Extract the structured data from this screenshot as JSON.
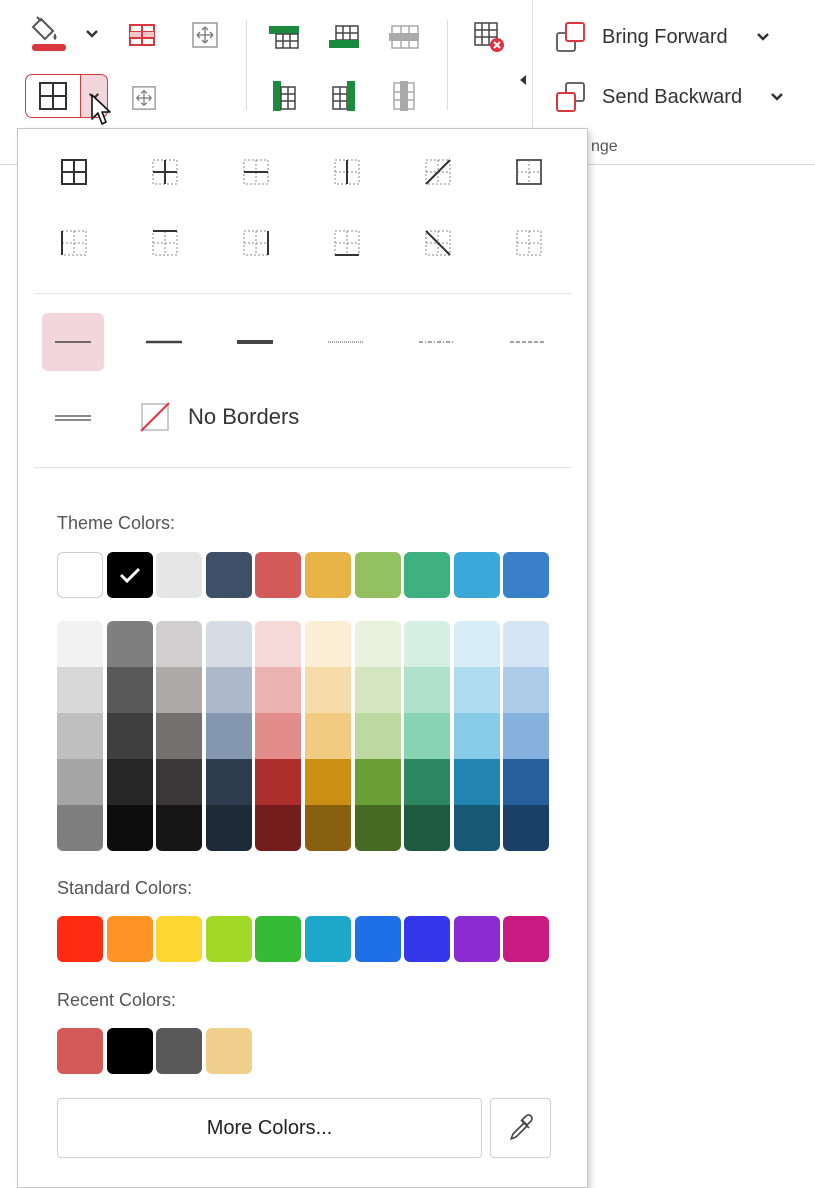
{
  "ribbon": {
    "bring_forward": "Bring Forward",
    "send_backward": "Send Backward",
    "group_label_partial": "nge"
  },
  "border_panel": {
    "no_borders": "No Borders",
    "theme_colors_label": "Theme Colors:",
    "standard_colors_label": "Standard Colors:",
    "recent_colors_label": "Recent Colors:",
    "more_colors": "More Colors...",
    "selected_line_style": "thin",
    "selected_theme_color": "#000000"
  },
  "colors": {
    "accent": "#d9383f",
    "selected_bg": "#f2d6dc",
    "table_green": "#1a8a3c"
  },
  "theme_colors": [
    "#ffffff",
    "#000000",
    "#e7e6e6",
    "#3d5068",
    "#d35a58",
    "#e8b447",
    "#93c162",
    "#3fb07f",
    "#3aa8d8",
    "#3a7fc9"
  ],
  "theme_shades": [
    [
      "#f2f2f2",
      "#d8d8d8",
      "#bfbfbf",
      "#a5a5a5",
      "#7f7f7f"
    ],
    [
      "#7f7f7f",
      "#595959",
      "#3f3f3f",
      "#262626",
      "#0d0d0d"
    ],
    [
      "#d0cece",
      "#aeaaaa",
      "#757070",
      "#3a3838",
      "#171616"
    ],
    [
      "#d6dce4",
      "#adb9ca",
      "#8497b0",
      "#2e3c4e",
      "#1f2a37"
    ],
    [
      "#f5d8d8",
      "#ebb3b2",
      "#e28d8c",
      "#ac2f2d",
      "#731e1d"
    ],
    [
      "#fbeed5",
      "#f6dcaa",
      "#f1cb81",
      "#cc8f16",
      "#89600f"
    ],
    [
      "#e9f2df",
      "#d3e6c0",
      "#bdd9a1",
      "#6a9f36",
      "#476a24"
    ],
    [
      "#d7f0e5",
      "#afe1cb",
      "#88d3b1",
      "#2d8760",
      "#1e5a40"
    ],
    [
      "#d7eef7",
      "#afdcef",
      "#88cbe8",
      "#2284b0",
      "#175875"
    ],
    [
      "#d6e5f4",
      "#aecbe9",
      "#86b1de",
      "#275f9c",
      "#1a3f68"
    ]
  ],
  "standard_colors": [
    "#ff2a12",
    "#ff9425",
    "#ffd733",
    "#a2d826",
    "#35bb36",
    "#1ca7cb",
    "#1f6fe9",
    "#3538ea",
    "#8b2bd1",
    "#c81a81"
  ],
  "recent_colors": [
    "#d35a58",
    "#000000",
    "#595959",
    "#f1cf8d"
  ],
  "icons": [
    "fill-bucket-icon",
    "chevron-down-icon",
    "table-row-icon",
    "move-icon",
    "all-borders-icon",
    "chevron-down-icon",
    "move-icon",
    "insert-row-above-icon",
    "insert-row-below-icon",
    "delete-row-icon",
    "insert-col-left-icon",
    "insert-col-right-icon",
    "delete-col-icon",
    "delete-table-icon",
    "bring-forward-icon",
    "send-backward-icon",
    "eyedropper-icon",
    "checkmark-icon",
    "no-borders-icon",
    "mouse-cursor-icon"
  ]
}
